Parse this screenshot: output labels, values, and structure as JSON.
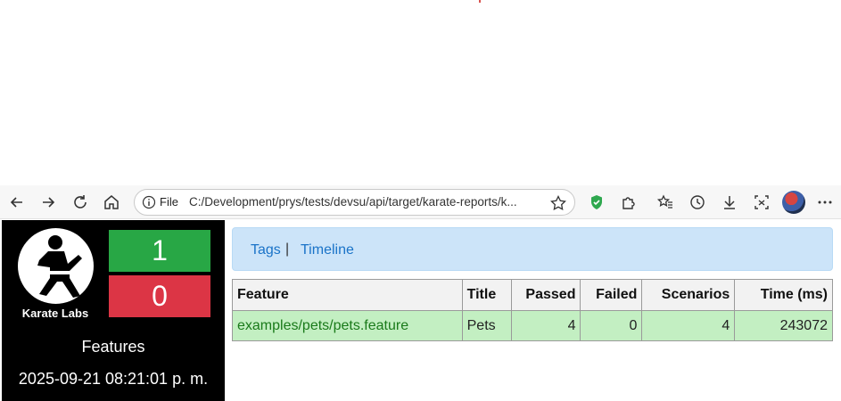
{
  "browser": {
    "address": {
      "scheme_label": "File",
      "url": "C:/Development/prys/tests/devsu/api/target/karate-reports/k..."
    },
    "icons": [
      "back-icon",
      "forward-icon",
      "refresh-icon",
      "home-icon",
      "info-icon",
      "favorite-star-icon",
      "shield-extension-icon",
      "extensions-icon",
      "favorites-icon",
      "history-icon",
      "downloads-icon",
      "screenshot-icon",
      "profile-avatar",
      "more-icon"
    ]
  },
  "report": {
    "logo_text": "Karate Labs",
    "passed_count": "1",
    "failed_count": "0",
    "section_title": "Features",
    "generated_at": "2025-09-21 08:21:01 p. m.",
    "nav": {
      "tags": "Tags",
      "separator": "|",
      "timeline": "Timeline"
    },
    "table": {
      "headers": [
        "Feature",
        "Title",
        "Passed",
        "Failed",
        "Scenarios",
        "Time (ms)"
      ],
      "rows": [
        [
          "examples/pets/pets.feature",
          "Pets",
          "4",
          "0",
          "4",
          "243072"
        ]
      ]
    }
  },
  "colors": {
    "passed": "#28a745",
    "failed": "#dc3545",
    "row_pass": "#c3efc2",
    "nav_bg": "#cce4f9",
    "link": "#1a73c8"
  }
}
